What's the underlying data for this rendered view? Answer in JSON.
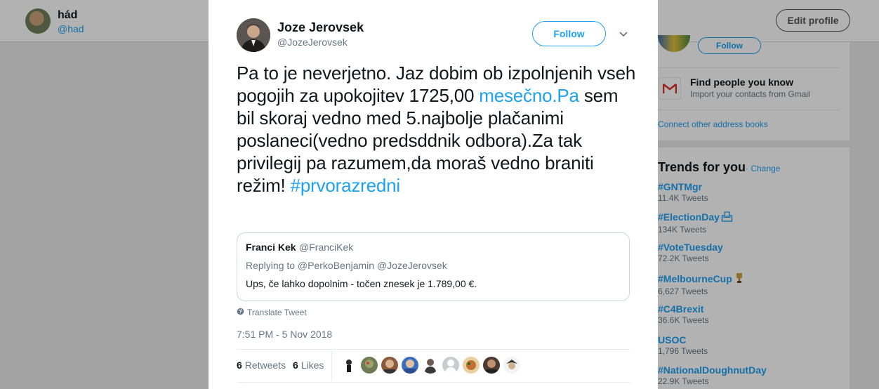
{
  "background_profile": {
    "name": "hád",
    "handle": "@had",
    "edit_profile_label": "Edit profile"
  },
  "sidebar": {
    "follow_label": "Follow",
    "find_people_title": "Find people you know",
    "find_people_subtitle": "Import your contacts from Gmail",
    "connect_link": "Connect other address books",
    "trends_title": "Trends for you",
    "trends_change": "· Change",
    "trends": [
      {
        "name": "#GNTMgr",
        "count": "11.4K Tweets",
        "icon": ""
      },
      {
        "name": "#ElectionDay",
        "count": "134K Tweets",
        "icon": "ballot-box-icon"
      },
      {
        "name": "#VoteTuesday",
        "count": "72.2K Tweets",
        "icon": ""
      },
      {
        "name": "#MelbourneCup",
        "count": "6,627 Tweets",
        "icon": "trophy-icon"
      },
      {
        "name": "#C4Brexit",
        "count": "36.6K Tweets",
        "icon": ""
      },
      {
        "name": "USOC",
        "count": "1,796 Tweets",
        "icon": ""
      },
      {
        "name": "#NationalDoughnutDay",
        "count": "22.9K Tweets",
        "icon": ""
      }
    ]
  },
  "tweet": {
    "author_name": "Joze Jerovsek",
    "author_handle": "@JozeJerovsek",
    "follow_label": "Follow",
    "text_part1": "Pa to je neverjetno. Jaz dobim ob izpolnjenih vseh pogojih za upokojitev 1725,00 ",
    "text_link": "mesečno.Pa",
    "text_part2": " sem bil skoraj vedno med 5.najbolje plačanimi poslaneci(vedno predsddnik odbora).Za tak privilegij pa razumem,da moraš vedno braniti režim! ",
    "text_hashtag": "#prvorazredni",
    "quote": {
      "name": "Franci Kek",
      "handle": "@FranciKek",
      "replying_to": "Replying to @PerkoBenjamin @JozeJerovsek",
      "text": "Ups, če lahko dopolnim - točen znesek je 1.789,00 €."
    },
    "translate_label": "Translate Tweet",
    "timestamp": "7:51 PM - 5 Nov 2018",
    "retweets_count": "6",
    "retweets_label": "Retweets",
    "likes_count": "6",
    "likes_label": "Likes"
  },
  "colors": {
    "accent": "#1da1f2",
    "text_primary": "#14171a",
    "text_secondary": "#657786",
    "border": "#ccd6dd"
  }
}
